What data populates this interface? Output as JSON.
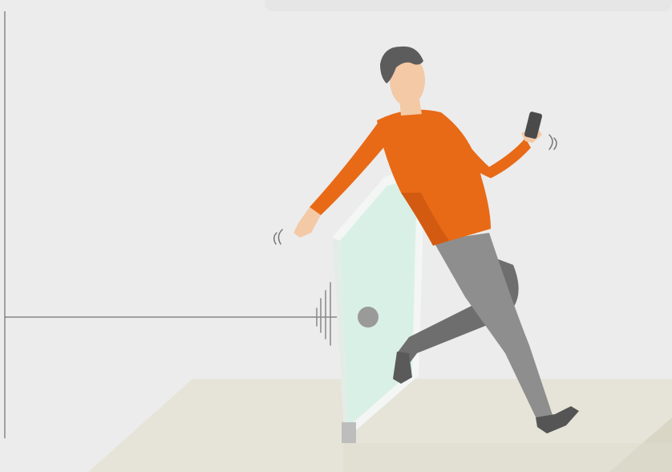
{
  "scene": {
    "description_label": "",
    "colors": {
      "background": "#ececec",
      "floor_top": "#e6e4d8",
      "floor_side": "#d9d6c6",
      "sweater": "#e86a17",
      "sweater_shadow": "#c95610",
      "pants": "#8e8e8e",
      "pants_dark": "#6e6e6e",
      "skin": "#f4c9a6",
      "hair": "#5c5c5c",
      "glass": "#d6efe4",
      "glass_frame": "#f3f6f4",
      "sensor": "#9a9a9a",
      "line": "#555555",
      "phone": "#4a4a4a"
    },
    "icons": [
      "person-falling-illustration",
      "glass-door-icon",
      "smartphone-icon",
      "motion-sensor-icon",
      "vibration-lines-icon"
    ]
  }
}
